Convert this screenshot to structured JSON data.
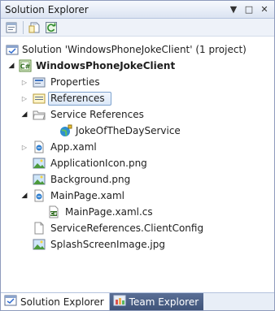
{
  "window": {
    "title": "Solution Explorer",
    "controls": {
      "dropdown": "▼",
      "maximize": "□",
      "close": "✕"
    }
  },
  "toolbar": {
    "buttons": [
      "properties-icon",
      "show-all-files-icon",
      "refresh-icon"
    ]
  },
  "tree": {
    "solution": "Solution 'WindowsPhoneJokeClient' (1 project)",
    "project": "WindowsPhoneJokeClient",
    "items": {
      "properties": "Properties",
      "references": "References",
      "service_references": "Service References",
      "joke_service": "JokeOfTheDayService",
      "app_xaml": "App.xaml",
      "app_icon": "ApplicationIcon.png",
      "background": "Background.png",
      "mainpage_xaml": "MainPage.xaml",
      "mainpage_cs": "MainPage.xaml.cs",
      "client_config": "ServiceReferences.ClientConfig",
      "splash": "SplashScreenImage.jpg"
    },
    "selected": "References"
  },
  "tabs": {
    "solution_explorer": "Solution Explorer",
    "team_explorer": "Team Explorer"
  },
  "colors": {
    "accent": "#8e9bbc",
    "selection": "#dbe8f8",
    "inactive_tab": "#3f5379"
  }
}
